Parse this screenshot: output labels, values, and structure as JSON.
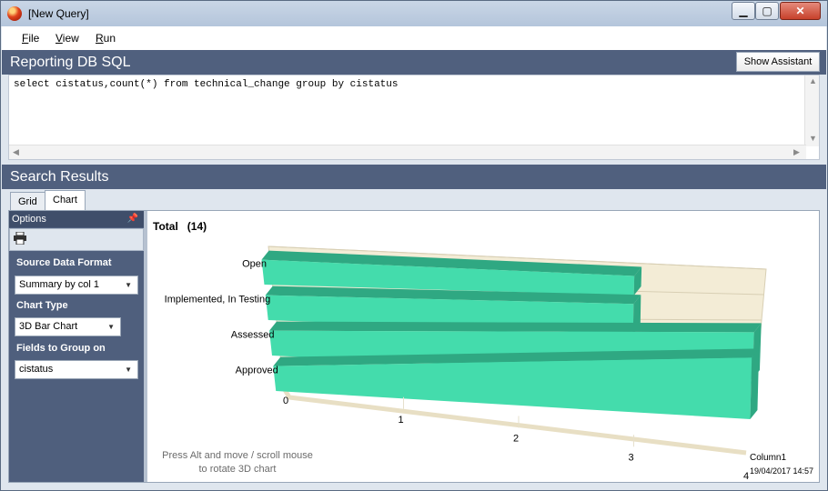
{
  "window": {
    "title": "[New Query]",
    "controls": {
      "minimize": "▁",
      "maximize": "▢",
      "close": "✕"
    }
  },
  "menu": {
    "items": [
      "File",
      "View",
      "Run"
    ]
  },
  "sql_section": {
    "title": "Reporting DB SQL",
    "assistant_button": "Show Assistant",
    "query": "select cistatus,count(*) from technical_change group by cistatus"
  },
  "results_section": {
    "title": "Search Results",
    "tabs": [
      "Grid",
      "Chart"
    ],
    "active_tab": "Chart"
  },
  "options_panel": {
    "title": "Options",
    "source_data_format_label": "Source Data Format",
    "source_data_format_value": "Summary by col 1",
    "chart_type_label": "Chart Type",
    "chart_type_value": "3D Bar Chart",
    "fields_label": "Fields to Group on",
    "fields_value": "cistatus"
  },
  "chart": {
    "header": "Total",
    "header_count": "(14)",
    "hint": "Press Alt and move / scroll mouse to rotate 3D chart",
    "series_label": "Column1",
    "timestamp": "19/04/2017 14:57"
  },
  "chart_data": {
    "type": "bar",
    "orientation": "horizontal",
    "categories": [
      "Open",
      "Implemented, In Testing",
      "Assessed",
      "Approved"
    ],
    "values": [
      3,
      3,
      4,
      4
    ],
    "x_ticks": [
      "0",
      "1",
      "2",
      "3",
      "4"
    ],
    "xlim": [
      0,
      4
    ],
    "series": [
      {
        "name": "Column1",
        "values": [
          3,
          3,
          4,
          4
        ]
      }
    ],
    "colors": {
      "bar": "#44dcac",
      "bar_dark": "#2fa882",
      "wall": "#f3ecd6"
    }
  }
}
